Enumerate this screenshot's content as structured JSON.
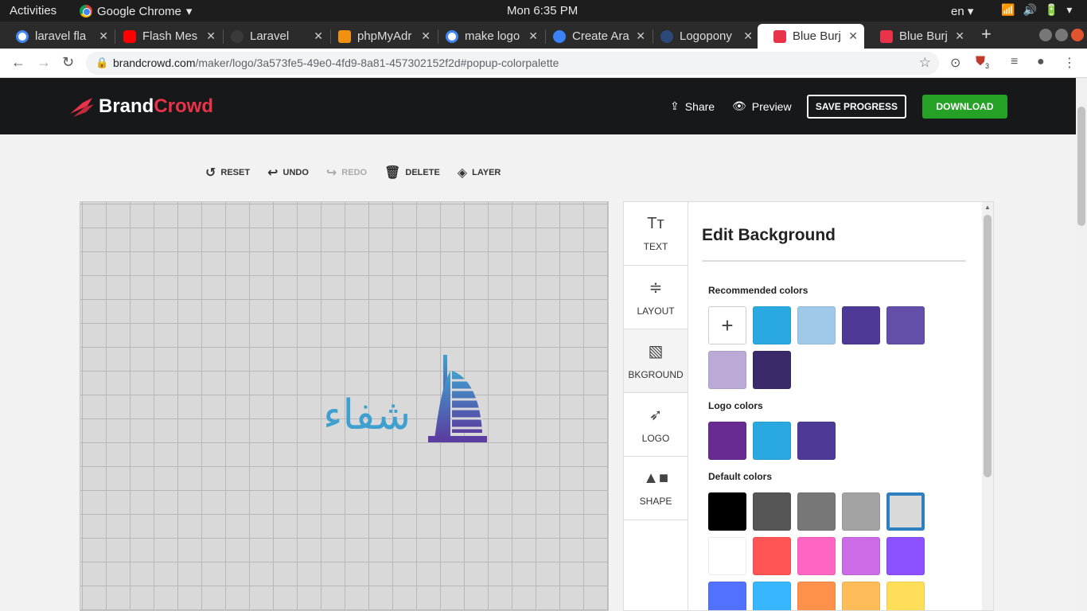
{
  "os": {
    "activities": "Activities",
    "app_name": "Google Chrome",
    "clock": "Mon  6:35 PM",
    "lang": "en"
  },
  "tabs": [
    {
      "title": "laravel fla",
      "favicon_color": "#4285f4"
    },
    {
      "title": "Flash Mes",
      "favicon_color": "#ff0000"
    },
    {
      "title": "Laravel",
      "favicon_color": "#444444"
    },
    {
      "title": "phpMyAdr",
      "favicon_color": "#f29111"
    },
    {
      "title": "make logo",
      "favicon_color": "#4285f4"
    },
    {
      "title": "Create Ara",
      "favicon_color": "#3b82f6"
    },
    {
      "title": "Logopony",
      "favicon_color": "#2b4a7a"
    },
    {
      "title": "Blue Burj A",
      "favicon_color": "#e8334a"
    },
    {
      "title": "Blue Burj",
      "favicon_color": "#e8334a"
    }
  ],
  "address": {
    "domain": "brandcrowd.com",
    "path": "/maker/logo/3a573fe5-49e0-4fd9-8a81-457302152f2d#popup-colorpalette",
    "extension_badge": "3"
  },
  "header": {
    "brand": "Brand",
    "crowd": "Crowd",
    "share": "Share",
    "preview": "Preview",
    "save": "SAVE PROGRESS",
    "download": "DOWNLOAD"
  },
  "edit_tools": {
    "reset": "RESET",
    "undo": "UNDO",
    "redo": "REDO",
    "delete": "DELETE",
    "layer": "LAYER"
  },
  "canvas": {
    "logo_text": "شفاء"
  },
  "sidenav": {
    "text": "TEXT",
    "layout": "LAYOUT",
    "background": "BKGROUND",
    "logo": "LOGO",
    "shape": "SHAPE"
  },
  "panel": {
    "title": "Edit Background",
    "recommended_label": "Recommended colors",
    "logo_label": "Logo colors",
    "default_label": "Default colors",
    "recommended_colors": [
      "#2aa9e0",
      "#9ec9e8",
      "#4e3a96",
      "#634ea8",
      "#bcaad6",
      "#3a2a6a"
    ],
    "logo_colors": [
      "#682b91",
      "#2aa9e0",
      "#4e3a96"
    ],
    "default_colors": [
      "#000000",
      "#555555",
      "#777777",
      "#a3a3a3",
      "#d9d9d9",
      "#ffffff",
      "#ff5555",
      "#ff66c4",
      "#cb6ce6",
      "#8c52ff",
      "#5271ff",
      "#38b6ff",
      "#ff914d",
      "#ffbd59",
      "#ffde59"
    ],
    "selected_default_color": "#d9d9d9"
  }
}
